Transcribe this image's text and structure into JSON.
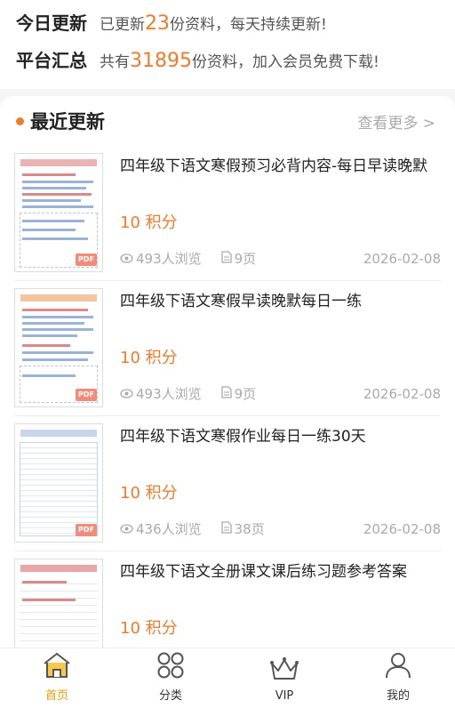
{
  "stats": {
    "today": {
      "title": "今日更新",
      "prefix": "已更新",
      "count": "23",
      "suffix": "份资料，每天持续更新!"
    },
    "total": {
      "title": "平台汇总",
      "prefix": "共有",
      "count": "31895",
      "suffix": "份资料，加入会员免费下载!"
    }
  },
  "recent": {
    "title": "最近更新",
    "more": "查看更多 >"
  },
  "items": [
    {
      "title": "四年级下语文寒假预习必背内容-每日早读晚默",
      "points": "10 积分",
      "views": "493人浏览",
      "pages": "9页",
      "date": "2026-02-08"
    },
    {
      "title": "四年级下语文寒假早读晚默每日一练",
      "points": "10 积分",
      "views": "493人浏览",
      "pages": "9页",
      "date": "2026-02-08"
    },
    {
      "title": "四年级下语文寒假作业每日一练30天",
      "points": "10 积分",
      "views": "436人浏览",
      "pages": "38页",
      "date": "2026-02-08"
    },
    {
      "title": "四年级下语文全册课文课后练习题参考答案",
      "points": "10 积分",
      "views": "",
      "pages": "",
      "date": ""
    }
  ],
  "thumb_badge": "PDF",
  "tabs": [
    {
      "label": "首页",
      "icon": "home-icon",
      "active": true
    },
    {
      "label": "分类",
      "icon": "grid-icon",
      "active": false
    },
    {
      "label": "VIP",
      "icon": "crown-icon",
      "active": false
    },
    {
      "label": "我的",
      "icon": "user-icon",
      "active": false
    }
  ],
  "colors": {
    "accent": "#f07a2a",
    "active_tab": "#e0a000"
  }
}
